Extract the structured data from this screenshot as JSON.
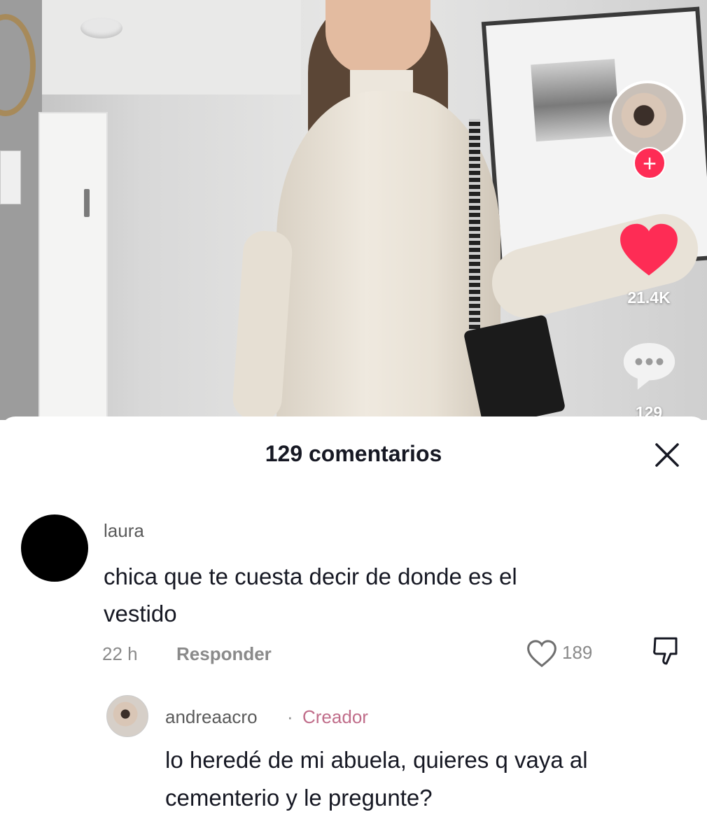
{
  "video": {
    "creator_avatar_alt": "andreaacro",
    "likes": "21.4K",
    "comments_count": "129"
  },
  "comments_panel": {
    "title": "129 comentarios",
    "comments": [
      {
        "username": "laura",
        "text_line1": "chica que te cuesta decir de donde es el",
        "text_line2": "vestido",
        "time": "22 h",
        "reply_label": "Responder",
        "likes": "189"
      }
    ],
    "reply": {
      "username": "andreaacro",
      "separator": "·",
      "badge": "Creador",
      "text_line1": "lo heredé de mi abuela, quieres q vaya al",
      "text_line2": "cementerio y le pregunte?"
    }
  },
  "colors": {
    "accent": "#fe2c55",
    "creator_badge": "#c06d8a"
  }
}
